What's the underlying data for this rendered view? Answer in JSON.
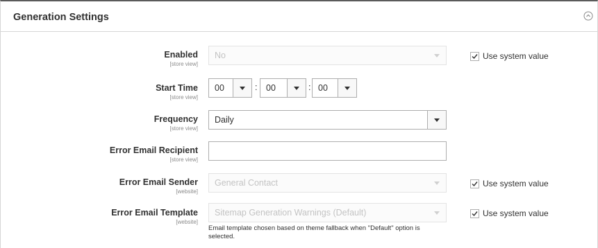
{
  "section": {
    "title": "Generation Settings"
  },
  "fields": {
    "enabled": {
      "label": "Enabled",
      "scope": "[store view]",
      "value": "No",
      "use_system_label": "Use system value",
      "use_system_checked": true
    },
    "start_time": {
      "label": "Start Time",
      "scope": "[store view]",
      "hour": "00",
      "minute": "00",
      "second": "00",
      "separator": ":"
    },
    "frequency": {
      "label": "Frequency",
      "scope": "[store view]",
      "value": "Daily"
    },
    "error_recipient": {
      "label": "Error Email Recipient",
      "scope": "[store view]",
      "value": ""
    },
    "error_sender": {
      "label": "Error Email Sender",
      "scope": "[website]",
      "value": "General Contact",
      "use_system_label": "Use system value",
      "use_system_checked": true
    },
    "error_template": {
      "label": "Error Email Template",
      "scope": "[website]",
      "value": "Sitemap Generation Warnings (Default)",
      "use_system_label": "Use system value",
      "use_system_checked": true,
      "note": "Email template chosen based on theme fallback when \"Default\" option is selected."
    }
  }
}
